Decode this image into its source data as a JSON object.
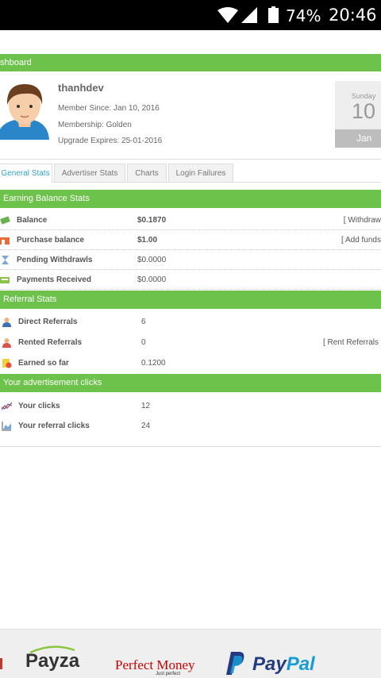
{
  "status_bar": {
    "battery": "74%",
    "time": "20:46"
  },
  "dashboard": {
    "title": "shboard"
  },
  "profile": {
    "username": "thanhdev",
    "member_since": "Member Since: Jan 10, 2016",
    "membership": "Membership: Golden",
    "upgrade_expires": "Upgrade Expires: 25-01-2016"
  },
  "calendar": {
    "weekday": "Sunday",
    "day": "10",
    "month": "Jan"
  },
  "tabs": [
    {
      "label": "General Stats",
      "active": true
    },
    {
      "label": "Advertiser Stats"
    },
    {
      "label": "Charts"
    },
    {
      "label": "Login Failures"
    }
  ],
  "earning": {
    "title": "Earning Balance Stats",
    "rows": [
      {
        "label": "Balance",
        "value": "$0.1870",
        "action": "[ Withdraw"
      },
      {
        "label": "Purchase balance",
        "value": "$1.00",
        "action": "[ Add funds"
      },
      {
        "label": "Pending Withdrawls",
        "value": "$0.0000"
      },
      {
        "label": "Payments Received",
        "value": "$0.0000"
      }
    ]
  },
  "referral": {
    "title": "Referral Stats",
    "rows": [
      {
        "label": "Direct Referrals",
        "value": "6"
      },
      {
        "label": "Rented Referrals",
        "value": "0",
        "action": "[ Rent Referrals"
      },
      {
        "label": "Earned so far",
        "value": "0.1200"
      }
    ]
  },
  "clicks": {
    "title": "Your advertisement clicks",
    "rows": [
      {
        "label": "Your clicks",
        "value": "12"
      },
      {
        "label": "Your referral clicks",
        "value": "24"
      }
    ]
  },
  "footer": {
    "payza": "Payza",
    "perfect_money": "Perfect Money",
    "perfect_money_tag": "Just perfect",
    "paypal_a": "Pay",
    "paypal_b": "Pal"
  },
  "colors": {
    "green": "#6cc24a",
    "tab_active": "#33a0c8",
    "calendar": "#eeeeee"
  }
}
